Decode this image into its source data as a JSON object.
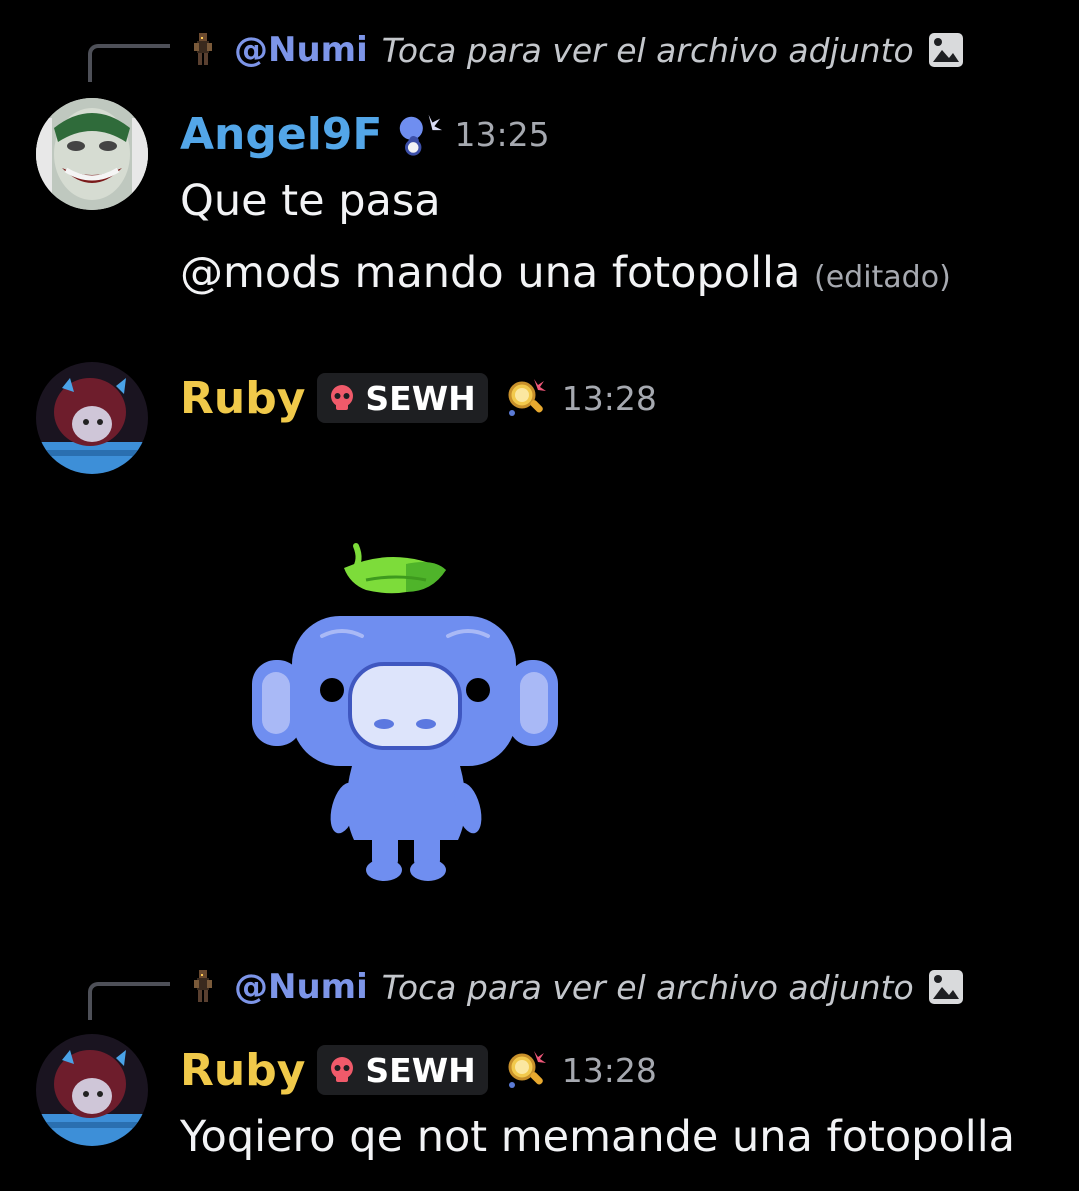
{
  "messages": [
    {
      "reply": {
        "author": "@Numi",
        "text": "Toca para ver el archivo adjunto",
        "icon": "image-icon"
      },
      "author": "Angel9F",
      "author_color": "#53a6e8",
      "time": "13:25",
      "lines": [
        "Que te pasa",
        "@mods mando una fotopolla"
      ],
      "edited": "(editado)"
    },
    {
      "author": "Ruby",
      "author_color": "#f0c94a",
      "tag": "SEWH",
      "time": "13:28",
      "sticker": "wumpus-sticker"
    },
    {
      "reply": {
        "author": "@Numi",
        "text": "Toca para ver el archivo adjunto",
        "icon": "image-icon"
      },
      "author": "Ruby",
      "author_color": "#f0c94a",
      "tag": "SEWH",
      "time": "13:28",
      "lines": [
        "Yoqiero qe not memande una fotopolla"
      ]
    }
  ],
  "colors": {
    "background": "#000000",
    "mention": "#7d95e8",
    "muted": "#a6a9b0"
  }
}
